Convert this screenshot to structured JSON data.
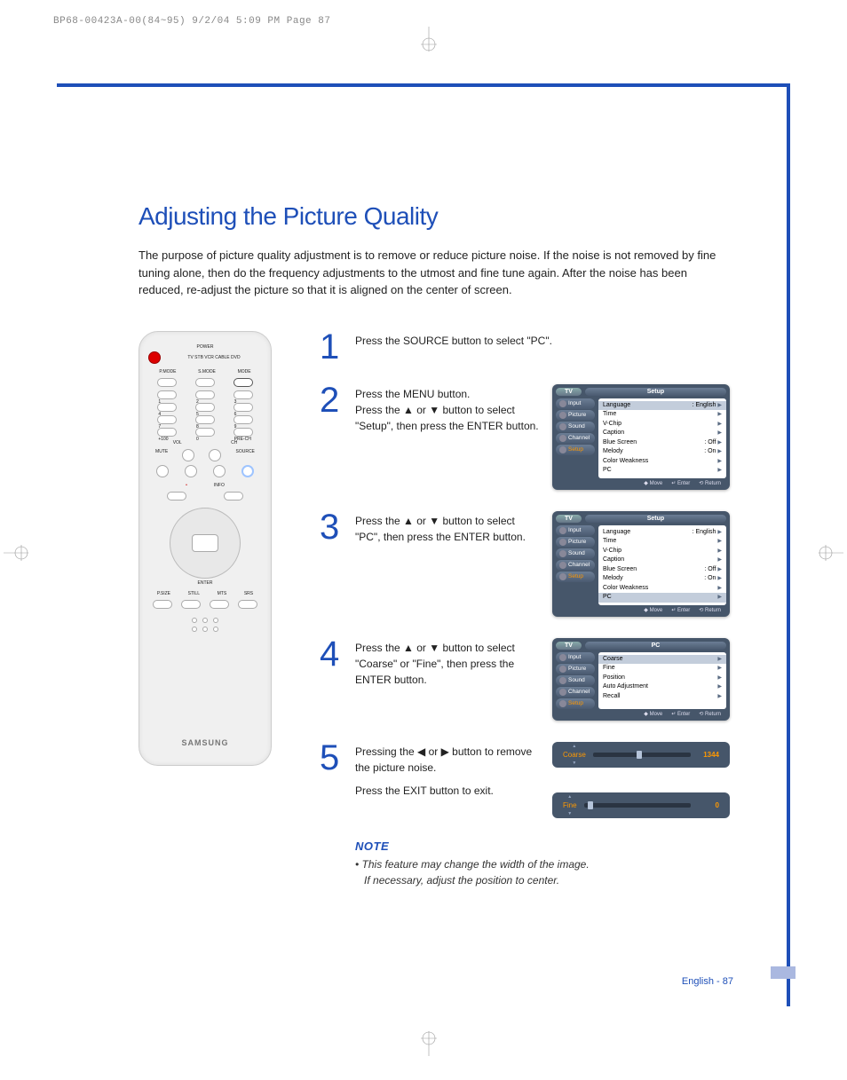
{
  "print_header": "BP68-00423A-00(84~95)  9/2/04  5:09 PM  Page 87",
  "title": "Adjusting the Picture Quality",
  "intro": "The purpose of picture quality adjustment is to remove or reduce picture noise. If the noise is not removed by fine tuning alone, then do the frequency adjustments to the utmost and fine tune again. After the noise has been reduced, re-adjust the picture so that it is aligned on the center of screen.",
  "remote_brand": "SAMSUNG",
  "remote_labels": {
    "power": "POWER",
    "modes": "TV  STB  VCR  CABLE  DVD",
    "pmode": "P.MODE",
    "smode": "S.MODE",
    "mode": "MODE",
    "vol": "VOL",
    "ch": "CH",
    "mute": "MUTE",
    "source": "SOURCE",
    "info": "INFO",
    "enter": "ENTER",
    "psize": "P.SIZE",
    "still": "STILL",
    "mts": "MTS",
    "srs": "SRS",
    "plus100": "+100",
    "prech": "PRE-CH"
  },
  "steps": [
    {
      "n": "1",
      "text": "Press the SOURCE button to select \"PC\"."
    },
    {
      "n": "2",
      "text": "Press the MENU button.\nPress the ▲ or ▼ button to select \"Setup\", then press the ENTER button."
    },
    {
      "n": "3",
      "text": "Press the ▲ or ▼ button to select \"PC\", then press the ENTER button."
    },
    {
      "n": "4",
      "text": "Press the ▲ or ▼ button to select \"Coarse\" or \"Fine\", then press the ENTER button."
    },
    {
      "n": "5",
      "text": "Pressing the ◀ or ▶ button to remove the picture noise.",
      "text2": "Press the EXIT button to exit."
    }
  ],
  "osd_common": {
    "tab": "TV",
    "side": [
      "Input",
      "Picture",
      "Sound",
      "Channel",
      "Setup"
    ],
    "footer": {
      "move": "Move",
      "enter": "Enter",
      "return": "Return"
    }
  },
  "osd2": {
    "title": "Setup",
    "rows": [
      {
        "l": "Language",
        "v": ": English"
      },
      {
        "l": "Time",
        "v": ""
      },
      {
        "l": "V-Chip",
        "v": ""
      },
      {
        "l": "Caption",
        "v": ""
      },
      {
        "l": "Blue Screen",
        "v": ": Off"
      },
      {
        "l": "Melody",
        "v": ": On"
      },
      {
        "l": "Color Weakness",
        "v": ""
      },
      {
        "l": "PC",
        "v": ""
      }
    ],
    "highlight": 0
  },
  "osd3": {
    "title": "Setup",
    "rows": [
      {
        "l": "Language",
        "v": ": English"
      },
      {
        "l": "Time",
        "v": ""
      },
      {
        "l": "V-Chip",
        "v": ""
      },
      {
        "l": "Caption",
        "v": ""
      },
      {
        "l": "Blue Screen",
        "v": ": Off"
      },
      {
        "l": "Melody",
        "v": ": On"
      },
      {
        "l": "Color Weakness",
        "v": ""
      },
      {
        "l": "PC",
        "v": ""
      }
    ],
    "highlight": 7
  },
  "osd4": {
    "title": "PC",
    "rows": [
      {
        "l": "Coarse",
        "v": ""
      },
      {
        "l": "Fine",
        "v": ""
      },
      {
        "l": "Position",
        "v": ""
      },
      {
        "l": "Auto Adjustment",
        "v": ""
      },
      {
        "l": "Recall",
        "v": ""
      }
    ],
    "highlight": 0
  },
  "slider_coarse": {
    "label": "Coarse",
    "value": "1344",
    "pos": 45
  },
  "slider_fine": {
    "label": "Fine",
    "value": "0",
    "pos": 4
  },
  "note": {
    "head": "NOTE",
    "bullet": "•",
    "l1": "This feature may change the width of the image.",
    "l2": "If necessary, adjust the position to center."
  },
  "page_num": "English - 87",
  "icons": {
    "updown": "◆",
    "enter_glyph": "↵",
    "return_glyph": "⟲"
  }
}
